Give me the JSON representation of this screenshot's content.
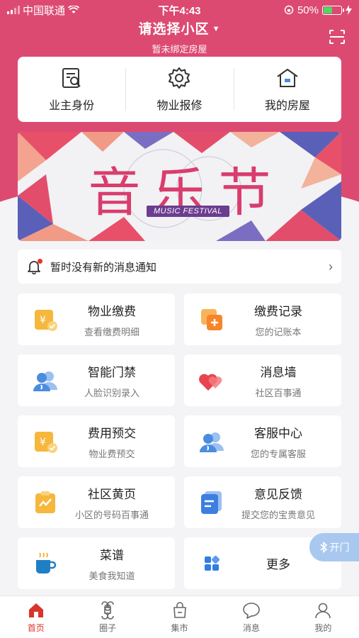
{
  "status_bar": {
    "carrier": "中国联通",
    "time": "下午4:43",
    "battery": "50%",
    "battery_level": 0.5
  },
  "header": {
    "community": "请选择小区",
    "subtitle": "暂未绑定房屋"
  },
  "quick_actions": [
    {
      "label": "业主身份",
      "icon": "id-card-icon"
    },
    {
      "label": "物业报修",
      "icon": "gear-icon"
    },
    {
      "label": "我的房屋",
      "icon": "house-icon"
    }
  ],
  "banner": {
    "title": "音乐节",
    "subtitle": "MUSIC FESTIVAL"
  },
  "notice": {
    "text": "暂时没有新的消息通知"
  },
  "services": [
    {
      "title": "物业缴费",
      "desc": "查看缴费明细",
      "icon": "property-fee-icon",
      "color": "#f6b73c"
    },
    {
      "title": "缴费记录",
      "desc": "您的记账本",
      "icon": "payment-record-icon",
      "color": "#f7932b"
    },
    {
      "title": "智能门禁",
      "desc": "人脸识别录入",
      "icon": "smart-access-icon",
      "color": "#4a8de0"
    },
    {
      "title": "消息墙",
      "desc": "社区百事通",
      "icon": "message-wall-icon",
      "color": "#e8454e"
    },
    {
      "title": "费用预交",
      "desc": "物业费预交",
      "icon": "prepay-icon",
      "color": "#f6b73c"
    },
    {
      "title": "客服中心",
      "desc": "您的专属客服",
      "icon": "customer-service-icon",
      "color": "#4a8de0"
    },
    {
      "title": "社区黄页",
      "desc": "小区的号码百事通",
      "icon": "yellow-pages-icon",
      "color": "#f6b73c"
    },
    {
      "title": "意见反馈",
      "desc": "提交您的宝贵意见",
      "icon": "feedback-icon",
      "color": "#3d7fe0"
    },
    {
      "title": "菜谱",
      "desc": "美食我知道",
      "icon": "recipe-icon",
      "color": "#1f7fc4"
    },
    {
      "title": "更多",
      "desc": "",
      "icon": "more-icon",
      "color": "#2f7fe0"
    }
  ],
  "float_button": {
    "label": "开门"
  },
  "tabs": [
    {
      "label": "首页",
      "icon": "home-icon",
      "active": true
    },
    {
      "label": "圈子",
      "icon": "circle-icon",
      "active": false
    },
    {
      "label": "集市",
      "icon": "market-icon",
      "active": false
    },
    {
      "label": "消息",
      "icon": "message-icon",
      "active": false
    },
    {
      "label": "我的",
      "icon": "profile-icon",
      "active": false
    }
  ],
  "colors": {
    "brand": "#dc4a72",
    "active_tab": "#d9352b",
    "background": "#f4f4f6"
  }
}
